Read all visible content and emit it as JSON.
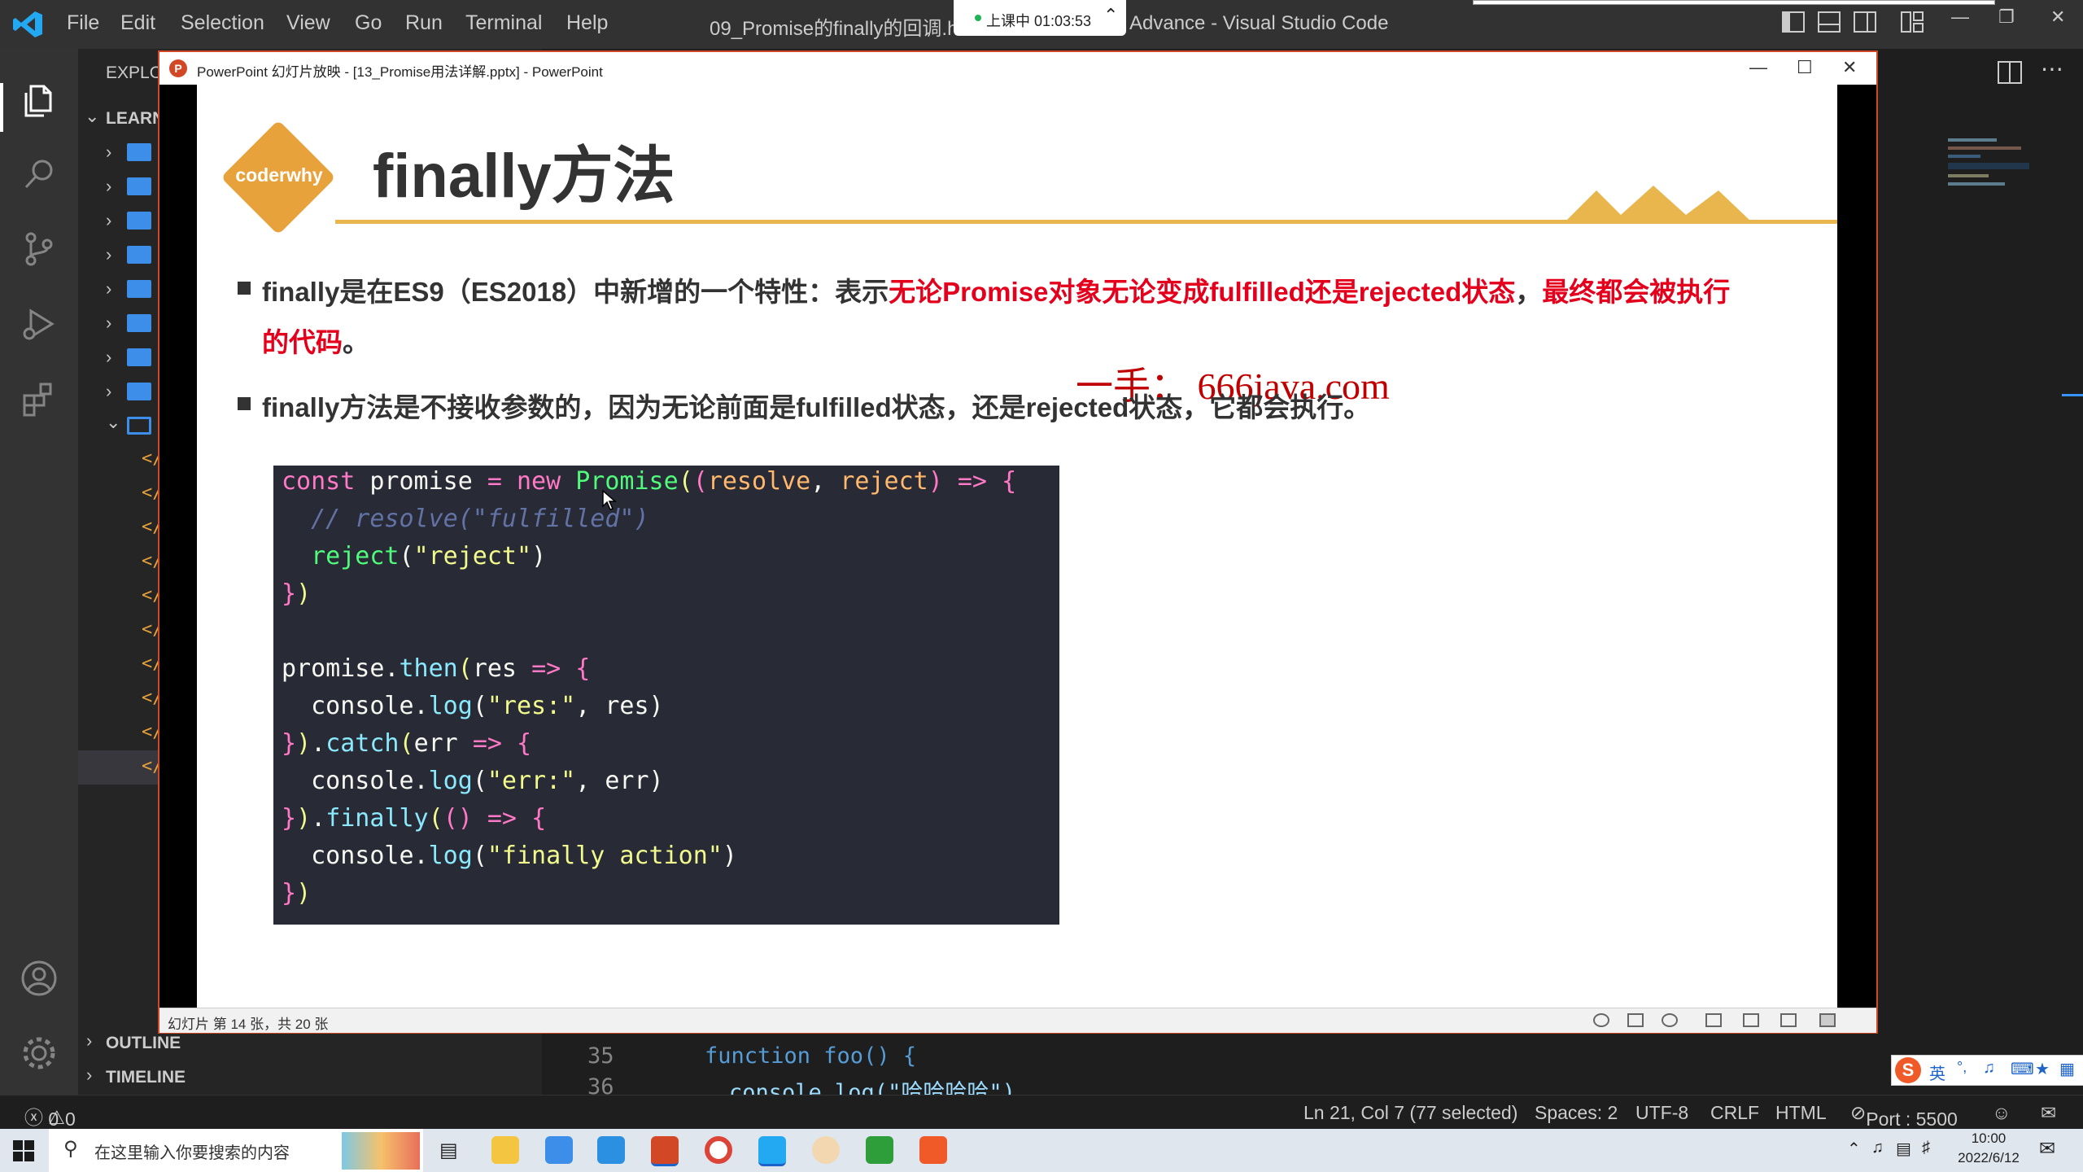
{
  "vscode": {
    "menu": [
      "File",
      "Edit",
      "Selection",
      "View",
      "Go",
      "Run",
      "Terminal",
      "Help"
    ],
    "title_left": "09_Promise的finally的回调.htr",
    "title_right": "Advance - Visual Studio Code",
    "explorer_header": "EXPLO",
    "workspace_header": "LEARN",
    "outline_label": "OUTLINE",
    "timeline_label": "TIMELINE",
    "line_numbers": [
      "35",
      "36"
    ],
    "code_line_35": "function foo() {",
    "code_line_36": "console.log(\"哈哈哈哈\")"
  },
  "recording": {
    "label": "上课中 01:03:53"
  },
  "powerpoint": {
    "window_title": "PowerPoint 幻灯片放映 - [13_Promise用法详解.pptx] - PowerPoint",
    "status": "幻灯片 第 14 张，共 20 张"
  },
  "slide": {
    "logo_text": "coderwhy",
    "title": "finally方法",
    "bullet1_part1": "finally是在ES9（ES2018）中新增的一个特性：表示",
    "bullet1_red1": "无论Promise对象无论变成fulfilled还是rejected状态",
    "bullet1_part2": "，",
    "bullet1_red2": "最终都会被执行",
    "bullet1_line2_red": "的代码",
    "bullet1_line2_end": "。",
    "watermark": "一手：  666java.com",
    "bullet2": "finally方法是不接收参数的，因为无论前面是fulfilled状态，还是rejected状态，它都会执行。"
  },
  "statusbar": {
    "errors": "0",
    "warnings": "0",
    "position": "Ln 21, Col 7 (77 selected)",
    "spaces": "Spaces: 2",
    "encoding": "UTF-8",
    "eol": "CRLF",
    "language": "HTML",
    "port": "Port : 5500"
  },
  "taskbar": {
    "search_placeholder": "在这里输入你要搜索的内容",
    "time": "10:00",
    "date": "2022/6/12",
    "ime_label": "英"
  },
  "colors": {
    "accent_orange": "#e8a23b",
    "slide_red": "#e4001c",
    "ppt_border": "#d24726"
  }
}
